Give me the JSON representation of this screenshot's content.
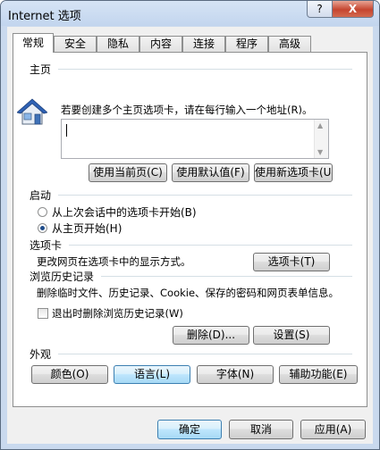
{
  "window": {
    "title": "Internet 选项",
    "help_label": "?",
    "close_label": "X"
  },
  "tabs": [
    {
      "label": "常规",
      "active": true
    },
    {
      "label": "安全"
    },
    {
      "label": "隐私"
    },
    {
      "label": "内容"
    },
    {
      "label": "连接"
    },
    {
      "label": "程序"
    },
    {
      "label": "高级"
    }
  ],
  "home": {
    "title": "主页",
    "description": "若要创建多个主页选项卡，请在每行输入一个地址(R)。",
    "url_value": "",
    "btn_current": "使用当前页(C)",
    "btn_default": "使用默认值(F)",
    "btn_new_tab": "使用新选项卡(U)"
  },
  "startup": {
    "title": "启动",
    "option_last_session": "从上次会话中的选项卡开始(B)",
    "option_home": "从主页开始(H)",
    "selected": "option_home"
  },
  "tabs_section": {
    "title": "选项卡",
    "description": "更改网页在选项卡中的显示方式。",
    "button": "选项卡(T)"
  },
  "history": {
    "title": "浏览历史记录",
    "description": "删除临时文件、历史记录、Cookie、保存的密码和网页表单信息。",
    "checkbox_label": "退出时删除浏览历史记录(W)",
    "checkbox_checked": false,
    "btn_delete": "删除(D)...",
    "btn_settings": "设置(S)"
  },
  "appearance": {
    "title": "外观",
    "btn_colors": "颜色(O)",
    "btn_languages": "语言(L)",
    "btn_fonts": "字体(N)",
    "btn_accessibility": "辅助功能(E)"
  },
  "footer": {
    "ok": "确定",
    "cancel": "取消",
    "apply": "应用(A)"
  }
}
